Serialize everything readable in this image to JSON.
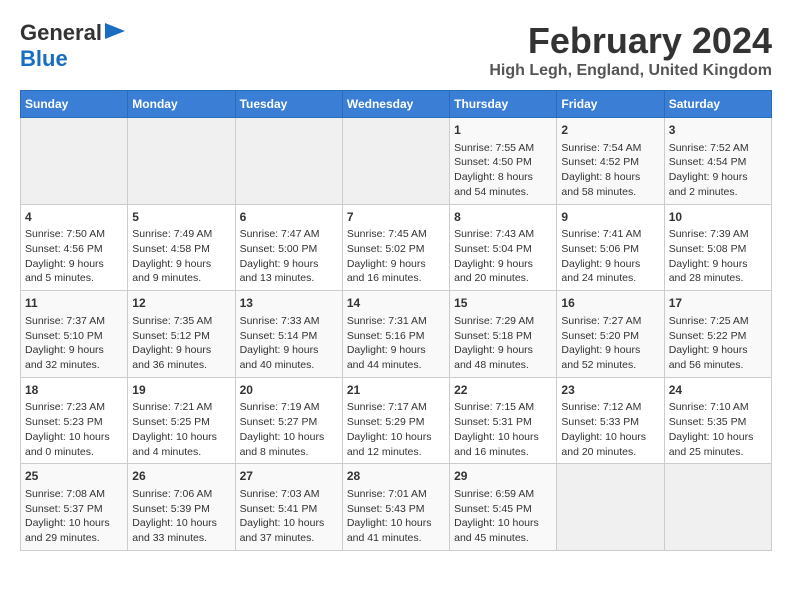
{
  "header": {
    "logo_general": "General",
    "logo_blue": "Blue",
    "title": "February 2024",
    "location": "High Legh, England, United Kingdom"
  },
  "days_of_week": [
    "Sunday",
    "Monday",
    "Tuesday",
    "Wednesday",
    "Thursday",
    "Friday",
    "Saturday"
  ],
  "weeks": [
    [
      {
        "day": "",
        "content": ""
      },
      {
        "day": "",
        "content": ""
      },
      {
        "day": "",
        "content": ""
      },
      {
        "day": "",
        "content": ""
      },
      {
        "day": "1",
        "content": "Sunrise: 7:55 AM\nSunset: 4:50 PM\nDaylight: 8 hours and 54 minutes."
      },
      {
        "day": "2",
        "content": "Sunrise: 7:54 AM\nSunset: 4:52 PM\nDaylight: 8 hours and 58 minutes."
      },
      {
        "day": "3",
        "content": "Sunrise: 7:52 AM\nSunset: 4:54 PM\nDaylight: 9 hours and 2 minutes."
      }
    ],
    [
      {
        "day": "4",
        "content": "Sunrise: 7:50 AM\nSunset: 4:56 PM\nDaylight: 9 hours and 5 minutes."
      },
      {
        "day": "5",
        "content": "Sunrise: 7:49 AM\nSunset: 4:58 PM\nDaylight: 9 hours and 9 minutes."
      },
      {
        "day": "6",
        "content": "Sunrise: 7:47 AM\nSunset: 5:00 PM\nDaylight: 9 hours and 13 minutes."
      },
      {
        "day": "7",
        "content": "Sunrise: 7:45 AM\nSunset: 5:02 PM\nDaylight: 9 hours and 16 minutes."
      },
      {
        "day": "8",
        "content": "Sunrise: 7:43 AM\nSunset: 5:04 PM\nDaylight: 9 hours and 20 minutes."
      },
      {
        "day": "9",
        "content": "Sunrise: 7:41 AM\nSunset: 5:06 PM\nDaylight: 9 hours and 24 minutes."
      },
      {
        "day": "10",
        "content": "Sunrise: 7:39 AM\nSunset: 5:08 PM\nDaylight: 9 hours and 28 minutes."
      }
    ],
    [
      {
        "day": "11",
        "content": "Sunrise: 7:37 AM\nSunset: 5:10 PM\nDaylight: 9 hours and 32 minutes."
      },
      {
        "day": "12",
        "content": "Sunrise: 7:35 AM\nSunset: 5:12 PM\nDaylight: 9 hours and 36 minutes."
      },
      {
        "day": "13",
        "content": "Sunrise: 7:33 AM\nSunset: 5:14 PM\nDaylight: 9 hours and 40 minutes."
      },
      {
        "day": "14",
        "content": "Sunrise: 7:31 AM\nSunset: 5:16 PM\nDaylight: 9 hours and 44 minutes."
      },
      {
        "day": "15",
        "content": "Sunrise: 7:29 AM\nSunset: 5:18 PM\nDaylight: 9 hours and 48 minutes."
      },
      {
        "day": "16",
        "content": "Sunrise: 7:27 AM\nSunset: 5:20 PM\nDaylight: 9 hours and 52 minutes."
      },
      {
        "day": "17",
        "content": "Sunrise: 7:25 AM\nSunset: 5:22 PM\nDaylight: 9 hours and 56 minutes."
      }
    ],
    [
      {
        "day": "18",
        "content": "Sunrise: 7:23 AM\nSunset: 5:23 PM\nDaylight: 10 hours and 0 minutes."
      },
      {
        "day": "19",
        "content": "Sunrise: 7:21 AM\nSunset: 5:25 PM\nDaylight: 10 hours and 4 minutes."
      },
      {
        "day": "20",
        "content": "Sunrise: 7:19 AM\nSunset: 5:27 PM\nDaylight: 10 hours and 8 minutes."
      },
      {
        "day": "21",
        "content": "Sunrise: 7:17 AM\nSunset: 5:29 PM\nDaylight: 10 hours and 12 minutes."
      },
      {
        "day": "22",
        "content": "Sunrise: 7:15 AM\nSunset: 5:31 PM\nDaylight: 10 hours and 16 minutes."
      },
      {
        "day": "23",
        "content": "Sunrise: 7:12 AM\nSunset: 5:33 PM\nDaylight: 10 hours and 20 minutes."
      },
      {
        "day": "24",
        "content": "Sunrise: 7:10 AM\nSunset: 5:35 PM\nDaylight: 10 hours and 25 minutes."
      }
    ],
    [
      {
        "day": "25",
        "content": "Sunrise: 7:08 AM\nSunset: 5:37 PM\nDaylight: 10 hours and 29 minutes."
      },
      {
        "day": "26",
        "content": "Sunrise: 7:06 AM\nSunset: 5:39 PM\nDaylight: 10 hours and 33 minutes."
      },
      {
        "day": "27",
        "content": "Sunrise: 7:03 AM\nSunset: 5:41 PM\nDaylight: 10 hours and 37 minutes."
      },
      {
        "day": "28",
        "content": "Sunrise: 7:01 AM\nSunset: 5:43 PM\nDaylight: 10 hours and 41 minutes."
      },
      {
        "day": "29",
        "content": "Sunrise: 6:59 AM\nSunset: 5:45 PM\nDaylight: 10 hours and 45 minutes."
      },
      {
        "day": "",
        "content": ""
      },
      {
        "day": "",
        "content": ""
      }
    ]
  ]
}
